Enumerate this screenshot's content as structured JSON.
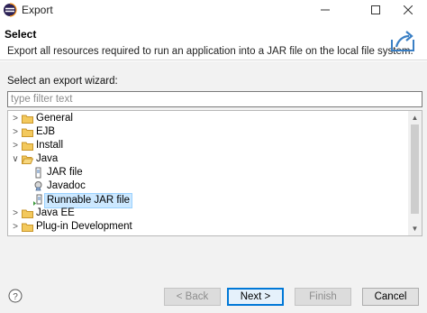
{
  "window": {
    "title": "Export"
  },
  "header": {
    "title": "Select",
    "description": "Export all resources required to run an application into a JAR file on the local file system."
  },
  "wizard": {
    "label": "Select an export wizard:",
    "filter_placeholder": "type filter text"
  },
  "tree": [
    {
      "label": "General",
      "depth": 0,
      "expanded": false,
      "type": "folder",
      "selected": false
    },
    {
      "label": "EJB",
      "depth": 0,
      "expanded": false,
      "type": "folder",
      "selected": false
    },
    {
      "label": "Install",
      "depth": 0,
      "expanded": false,
      "type": "folder",
      "selected": false
    },
    {
      "label": "Java",
      "depth": 0,
      "expanded": true,
      "type": "folder",
      "selected": false
    },
    {
      "label": "JAR file",
      "depth": 1,
      "type": "jar-icon",
      "selected": false
    },
    {
      "label": "Javadoc",
      "depth": 1,
      "type": "javadoc-icon",
      "selected": false
    },
    {
      "label": "Runnable JAR file",
      "depth": 1,
      "type": "runnable-jar-icon",
      "selected": true
    },
    {
      "label": "Java EE",
      "depth": 0,
      "expanded": false,
      "type": "folder",
      "selected": false
    },
    {
      "label": "Plug-in Development",
      "depth": 0,
      "expanded": false,
      "type": "folder",
      "selected": false
    }
  ],
  "buttons": {
    "back": "< Back",
    "next": "Next >",
    "finish": "Finish",
    "cancel": "Cancel"
  }
}
